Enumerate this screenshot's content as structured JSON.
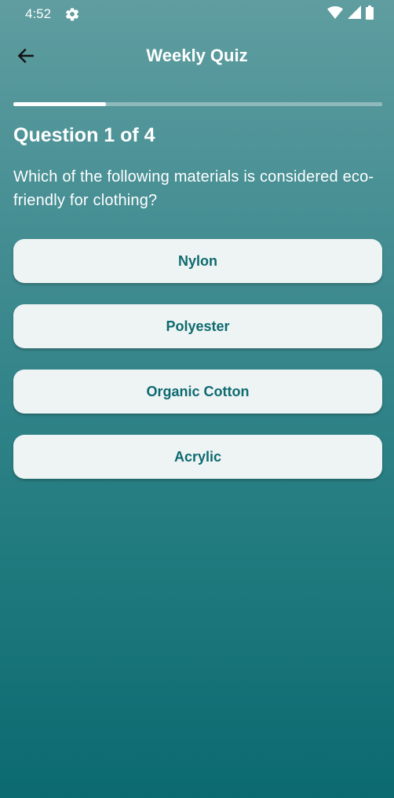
{
  "status_bar": {
    "time": "4:52",
    "icons": [
      "settings-gear-icon",
      "wifi-icon",
      "cell-signal-icon",
      "battery-icon"
    ]
  },
  "app_bar": {
    "title": "Weekly Quiz",
    "back_icon": "arrow-left-icon"
  },
  "quiz": {
    "progress_fraction": 0.25,
    "question_number": "Question 1 of 4",
    "question_text": "Which of the following materials is considered eco-friendly for clothing?",
    "options": [
      {
        "label": "Nylon"
      },
      {
        "label": "Polyester"
      },
      {
        "label": "Organic Cotton"
      },
      {
        "label": "Acrylic"
      }
    ]
  },
  "colors": {
    "gradient_top": "#5f9da0",
    "gradient_bottom": "#0b6a70",
    "option_background": "#eef4f4",
    "option_text": "#0e6a70"
  }
}
